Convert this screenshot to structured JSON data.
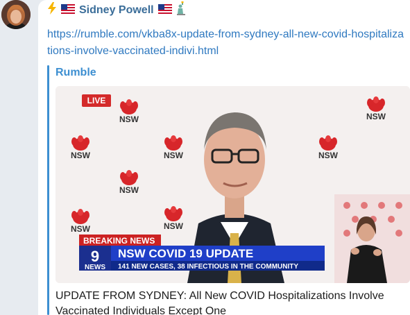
{
  "message": {
    "sender": {
      "prefix_icon": "lightning-icon",
      "name": "Sidney Powell",
      "flags": [
        "us-flag-icon",
        "us-flag-icon"
      ],
      "suffix_icon": "statue-of-liberty-icon",
      "name_color": "#3a6d99"
    },
    "link": "https://rumble.com/vkba8x-update-from-sydney-all-new-covid-hospitalizations-involve-vaccinated-indivi.html",
    "preview": {
      "site_name": "Rumble",
      "title": "UPDATE FROM SYDNEY: All New COVID Hospitalizations Involve Vaccinated Individuals Except One",
      "video": {
        "live_badge": "LIVE",
        "logo_text": "NSW",
        "breaking_label": "BREAKING NEWS",
        "channel_number": "9",
        "channel_label": "NEWS",
        "headline": "NSW COVID 19 UPDATE",
        "subheadline": "141 NEW CASES, 38 INFECTIOUS IN THE COMMUNITY"
      }
    }
  },
  "colors": {
    "link": "#2f79c0",
    "accent_bar": "#3d8fd1",
    "live_red": "#d42a2a",
    "headline_blue": "#1f3fc8",
    "nsw_red": "#d7262a"
  }
}
